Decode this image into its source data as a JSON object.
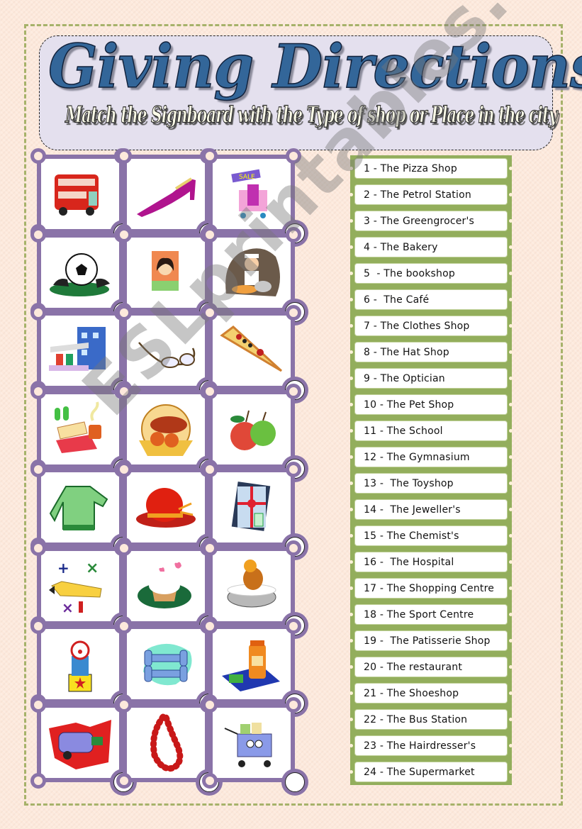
{
  "header": {
    "title": "Giving Directions",
    "subtitle": "Match the Signboard with the Type of shop or Place in the city"
  },
  "pictures": [
    {
      "icon": "double-decker-bus-icon"
    },
    {
      "icon": "high-heel-shoe-icon"
    },
    {
      "icon": "sale-shopping-cart-icon"
    },
    {
      "icon": "football-boots-icon"
    },
    {
      "icon": "hairstyle-portrait-icon"
    },
    {
      "icon": "waiter-serving-food-icon"
    },
    {
      "icon": "petrol-station-building-icon"
    },
    {
      "icon": "eyeglasses-icon"
    },
    {
      "icon": "pizza-slice-icon"
    },
    {
      "icon": "sandwich-and-coffee-icon"
    },
    {
      "icon": "bread-basket-icon"
    },
    {
      "icon": "apples-icon"
    },
    {
      "icon": "green-jumper-icon"
    },
    {
      "icon": "red-hat-icon"
    },
    {
      "icon": "books-gift-icon"
    },
    {
      "icon": "pencil-math-symbols-icon"
    },
    {
      "icon": "cupcake-icon"
    },
    {
      "icon": "dog-in-bath-icon"
    },
    {
      "icon": "jack-in-the-box-icon"
    },
    {
      "icon": "dumbbells-icon"
    },
    {
      "icon": "medicine-bottle-icon"
    },
    {
      "icon": "ambulance-icon"
    },
    {
      "icon": "red-bead-necklace-icon"
    },
    {
      "icon": "full-shopping-trolley-icon"
    }
  ],
  "shops": [
    "1 - The Pizza Shop",
    "2 - The Petrol Station",
    "3 - The Greengrocer's",
    "4 - The Bakery",
    "5  - The bookshop",
    "6 -  The Café",
    "7 - The Clothes Shop",
    "8 - The Hat Shop",
    "9 - The Optician",
    "10 - The Pet Shop",
    "11 - The School",
    "12 - The Gymnasium",
    "13 -  The Toyshop",
    "14 -  The Jeweller's",
    "15 - The Chemist's",
    "16 -  The Hospital",
    "17 - The Shopping Centre",
    "18 - The Sport Centre",
    "19 -  The Patisserie Shop",
    "20 - The restaurant",
    "21 - The Shoeshop",
    "22 - The Bus Station",
    "23 - The Hairdresser's",
    "24 - The Supermarket"
  ],
  "watermark": "ESLprintables.com"
}
